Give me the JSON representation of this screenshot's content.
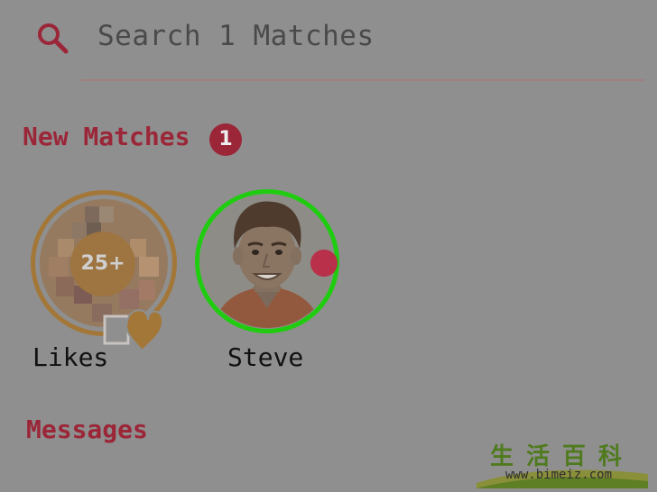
{
  "search": {
    "placeholder": "Search 1 Matches"
  },
  "new_matches": {
    "title": "New Matches",
    "count": "1"
  },
  "matches": [
    {
      "name": "Likes",
      "badge": "25+"
    },
    {
      "name": "Steve"
    }
  ],
  "messages": {
    "title": "Messages"
  },
  "watermark": {
    "chars": "生活百科",
    "url": "www.bimeiz.com"
  },
  "colors": {
    "background": "#8f8f8f",
    "accent": "#9b2638",
    "likes_ring": "#a37738",
    "online_ring": "#1fcc0f"
  }
}
